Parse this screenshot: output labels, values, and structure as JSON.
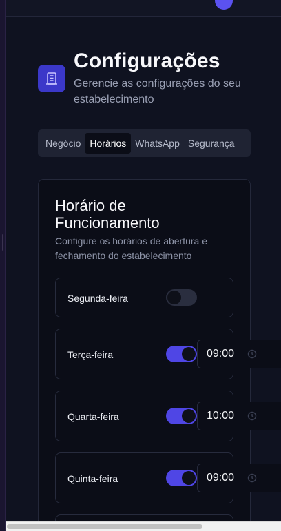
{
  "header": {
    "title": "Configurações",
    "subtitle": "Gerencie as configurações do seu estabelecimento",
    "icon": "building-icon"
  },
  "tabs": [
    {
      "label": "Negócio",
      "active": false
    },
    {
      "label": "Horários",
      "active": true
    },
    {
      "label": "WhatsApp",
      "active": false
    },
    {
      "label": "Segurança",
      "active": false
    }
  ],
  "card": {
    "title": "Horário de Funcionamento",
    "description": "Configure os horários de abertura e fechamento do estabelecimento"
  },
  "days": [
    {
      "label": "Segunda-feira",
      "enabled": false,
      "open_time": ""
    },
    {
      "label": "Terça-feira",
      "enabled": true,
      "open_time": "09:00"
    },
    {
      "label": "Quarta-feira",
      "enabled": true,
      "open_time": "10:00"
    },
    {
      "label": "Quinta-feira",
      "enabled": true,
      "open_time": "09:00"
    }
  ],
  "colors": {
    "accent": "#4f46e5",
    "background": "#0f1220",
    "card": "#0b0d17"
  }
}
